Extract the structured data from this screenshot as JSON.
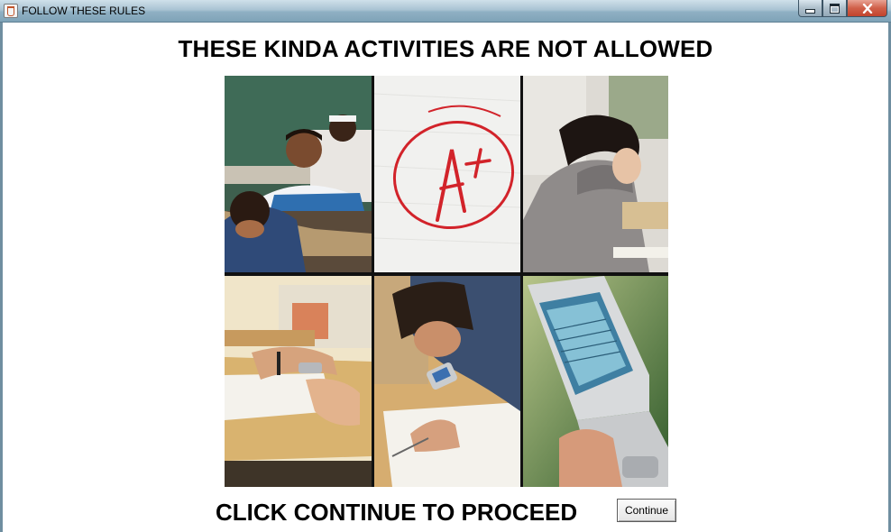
{
  "window": {
    "title": "FOLLOW THESE RULES"
  },
  "main": {
    "heading": "THESE KINDA ACTIVITIES ARE NOT ALLOWED",
    "instruction": "CLICK CONTINUE TO PROCEED",
    "continue_label": "Continue"
  },
  "icons": {
    "app": "java-cup-icon",
    "minimize": "minimize-icon",
    "maximize": "maximize-icon",
    "close": "close-icon"
  },
  "colors": {
    "grade_ink": "#d2232a",
    "close_button": "#c2432c",
    "title_bar": "#a9c3d3"
  }
}
